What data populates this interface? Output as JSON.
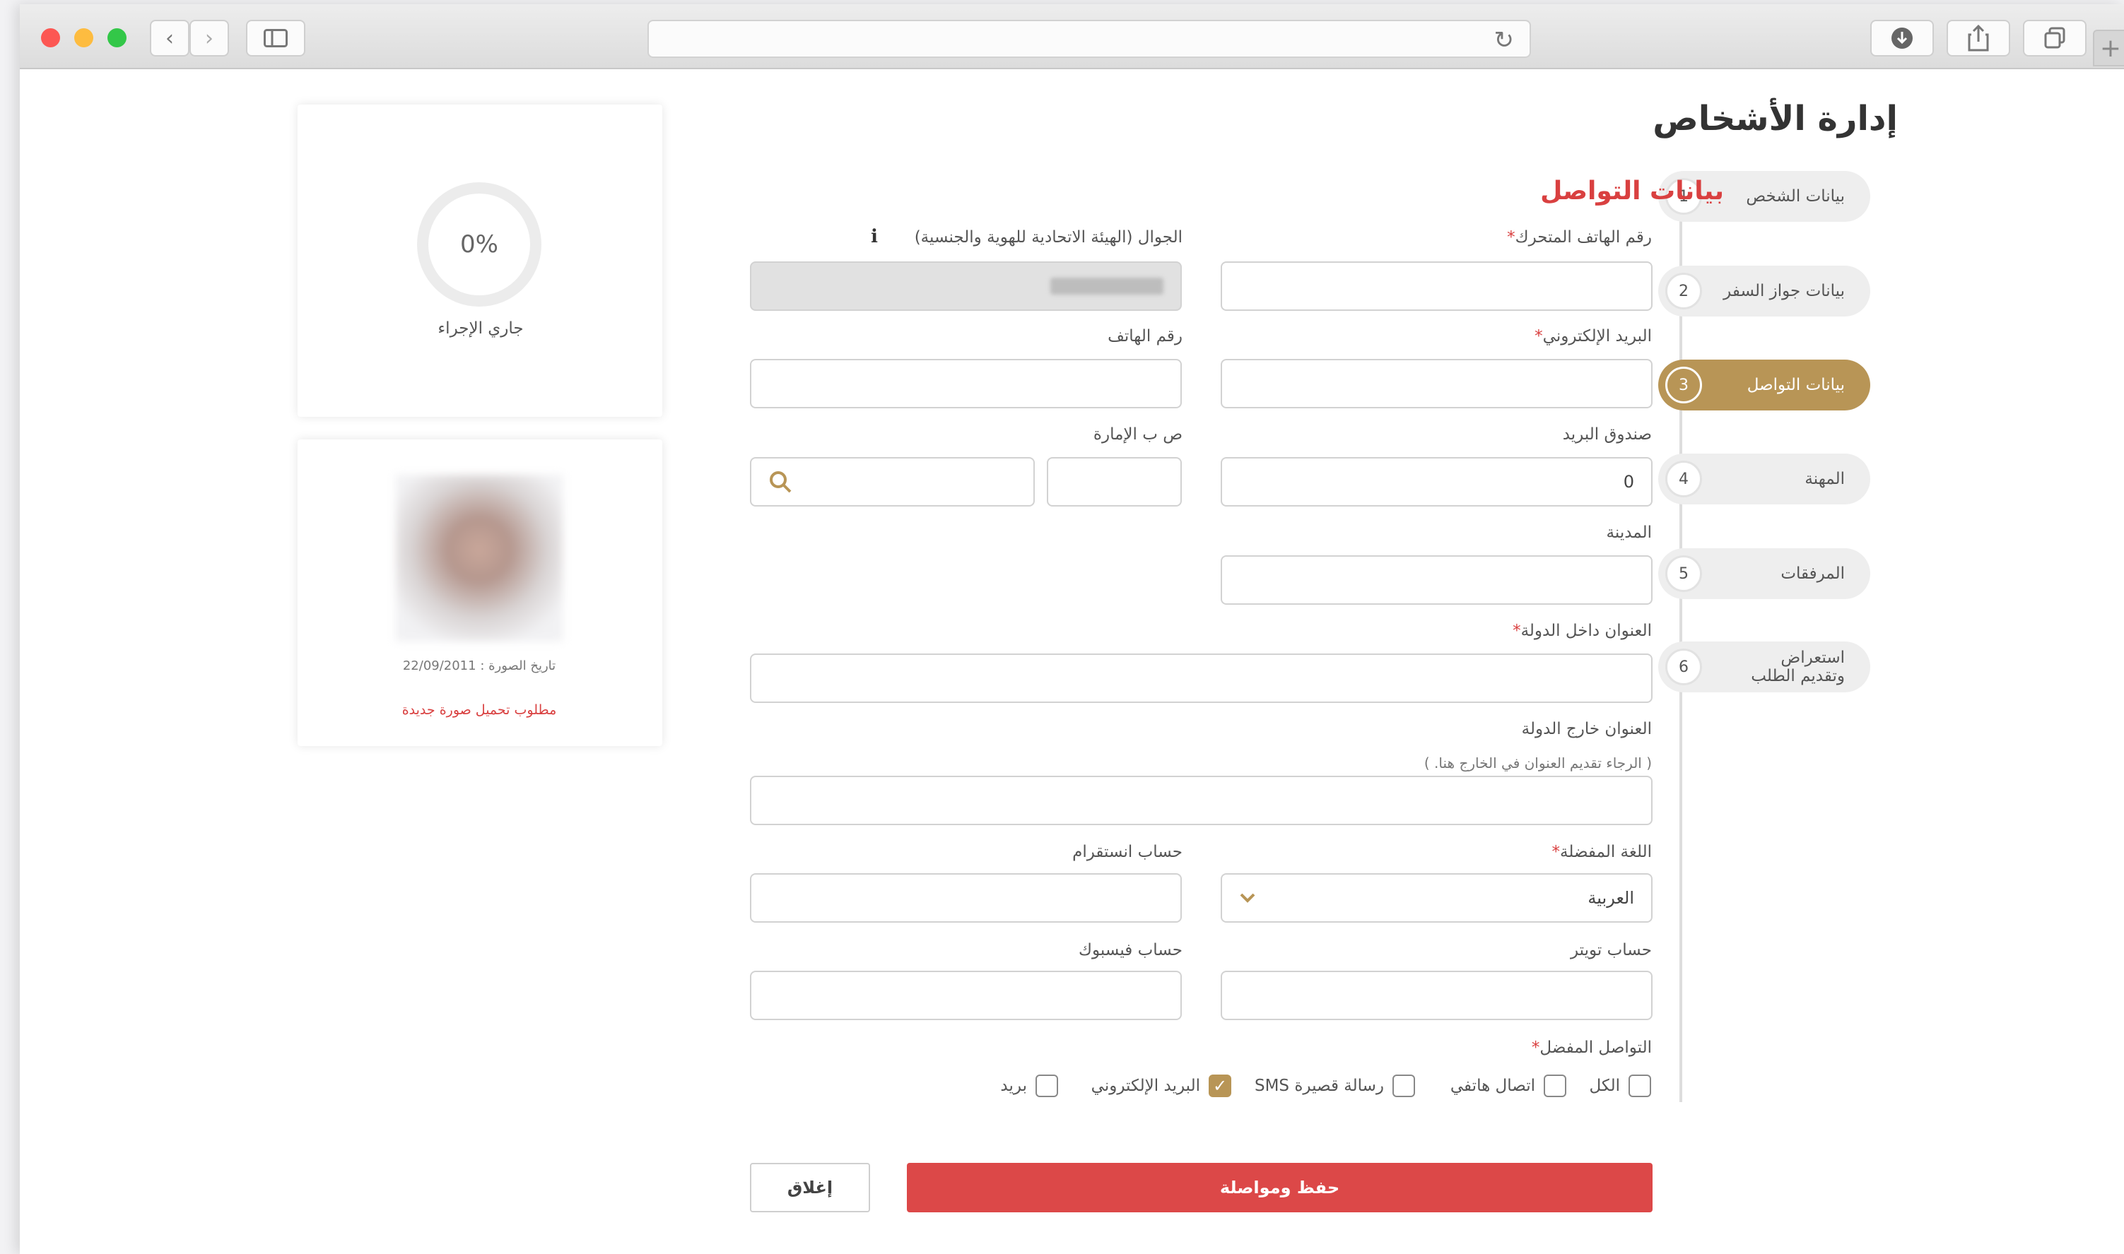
{
  "page": {
    "title": "إدارة الأشخاص",
    "section_title": "بيانات التواصل"
  },
  "steps": [
    {
      "num": "1",
      "label": "بيانات الشخص"
    },
    {
      "num": "2",
      "label": "بيانات جواز السفر"
    },
    {
      "num": "3",
      "label": "بيانات التواصل",
      "active": true
    },
    {
      "num": "4",
      "label": "المهنة"
    },
    {
      "num": "5",
      "label": "المرفقات"
    },
    {
      "num": "6",
      "label": "استعراض وتقديم الطلب"
    }
  ],
  "form": {
    "mobile_label": "رقم الهاتف المتحرك",
    "mobile_ica_label": "الجوال (الهيئة الاتحادية للهوية والجنسية)",
    "email_label": "البريد الإلكتروني",
    "phone_label": "رقم الهاتف",
    "pobox_label": "صندوق البريد",
    "pobox_value": "0",
    "pobox_emirate_label": "ص ب الإمارة",
    "city_label": "المدينة",
    "address_in_label": "العنوان داخل الدولة",
    "address_out_label": "العنوان خارج الدولة",
    "address_out_hint": "( الرجاء تقديم العنوان في الخارج هنا. )",
    "language_label": "اللغة المفضلة",
    "language_value": "العربية",
    "instagram_label": "حساب انستقرام",
    "twitter_label": "حساب تويتر",
    "facebook_label": "حساب فيسبوك",
    "contact_pref_label": "التواصل المفضل",
    "required_mark": "*",
    "contact_options": {
      "all": "الكل",
      "phone": "اتصال هاتفي",
      "sms": "رسالة قصيرة SMS",
      "email": "البريد الإلكتروني",
      "mail": "بريد"
    },
    "save_label": "حفظ ومواصلة",
    "close_label": "إغلاق"
  },
  "progress": {
    "percent_text": "0%",
    "value": 0,
    "status": "جاري الإجراء"
  },
  "photo": {
    "date_text": "تاريخ الصورة : 22/09/2011",
    "required_text": "مطلوب تحميل صورة جديدة"
  },
  "icons": {
    "info": "info-icon",
    "search": "search-icon",
    "chevron": "chevron-down-icon",
    "check": "check-icon"
  },
  "colors": {
    "accent": "#b89556",
    "primary_red": "#dc4848"
  }
}
